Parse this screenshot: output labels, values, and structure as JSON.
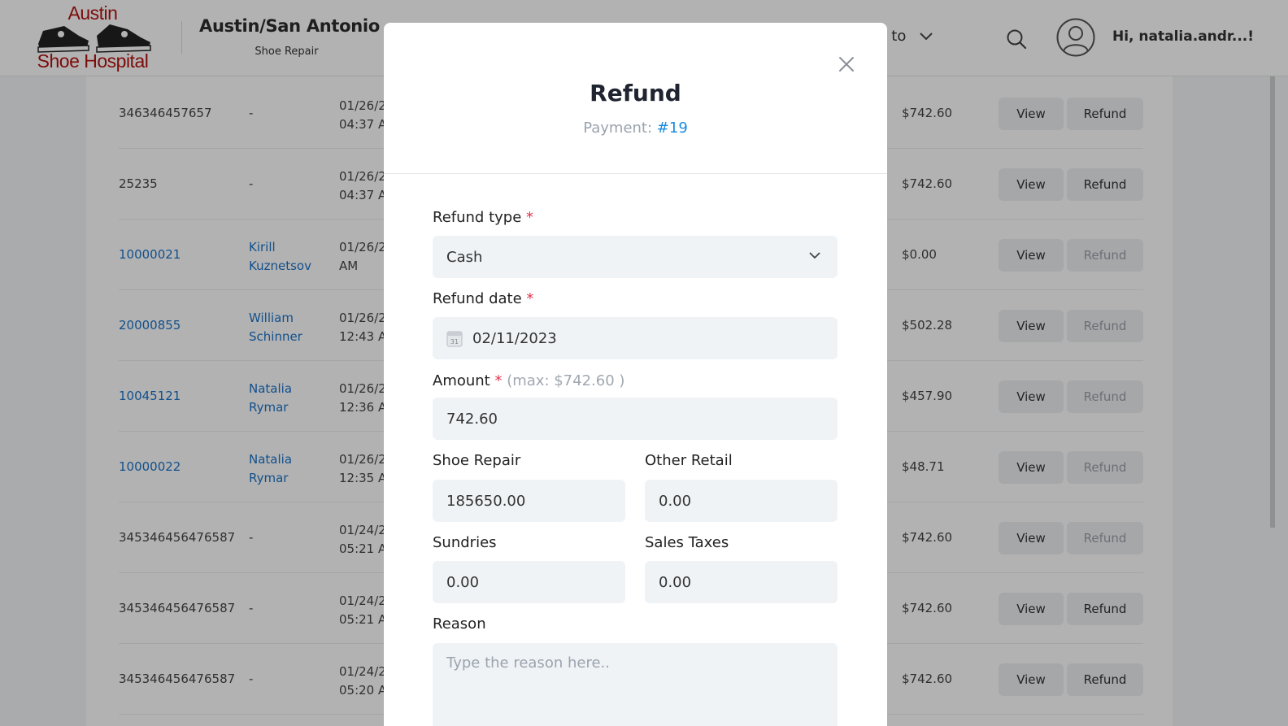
{
  "header": {
    "logo_top": "Austin",
    "logo_bottom": "Shoe Hospital",
    "store_name": "Austin/San Antonio",
    "store_sub": "Shoe Repair",
    "navigate_label": "gate to",
    "greeting": "Hi, natalia.andr...!"
  },
  "table": {
    "rows": [
      {
        "id": "346346457657",
        "name1": "-",
        "name2": "",
        "date1": "01/26/2",
        "date2": "04:37 A",
        "amount": "$742.60",
        "view": "View",
        "refund": "Refund",
        "refund_enabled": true,
        "link": false
      },
      {
        "id": "25235",
        "name1": "-",
        "name2": "",
        "date1": "01/26/2",
        "date2": "04:37 A",
        "amount": "$742.60",
        "view": "View",
        "refund": "Refund",
        "refund_enabled": true,
        "link": false
      },
      {
        "id": "10000021",
        "name1": "Kirill",
        "name2": "Kuznetsov",
        "date1": "01/26/2",
        "date2": "AM",
        "amount": "$0.00",
        "view": "View",
        "refund": "Refund",
        "refund_enabled": false,
        "link": true
      },
      {
        "id": "20000855",
        "name1": "William",
        "name2": "Schinner",
        "date1": "01/26/2",
        "date2": "12:43 A",
        "amount": "$502.28",
        "view": "View",
        "refund": "Refund",
        "refund_enabled": false,
        "link": true
      },
      {
        "id": "10045121",
        "name1": "Natalia",
        "name2": "Rymar",
        "date1": "01/26/2",
        "date2": "12:36 A",
        "amount": "$457.90",
        "view": "View",
        "refund": "Refund",
        "refund_enabled": false,
        "link": true
      },
      {
        "id": "10000022",
        "name1": "Natalia",
        "name2": "Rymar",
        "date1": "01/26/2",
        "date2": "12:35 A",
        "amount": "$48.71",
        "view": "View",
        "refund": "Refund",
        "refund_enabled": false,
        "link": true
      },
      {
        "id": "345346456476587",
        "name1": "-",
        "name2": "",
        "date1": "01/24/2",
        "date2": "05:21 A",
        "amount": "$742.60",
        "view": "View",
        "refund": "Refund",
        "refund_enabled": false,
        "link": false
      },
      {
        "id": "345346456476587",
        "name1": "-",
        "name2": "",
        "date1": "01/24/2",
        "date2": "05:21 A",
        "amount": "$742.60",
        "view": "View",
        "refund": "Refund",
        "refund_enabled": true,
        "link": false
      },
      {
        "id": "345346456476587",
        "name1": "-",
        "name2": "",
        "date1": "01/24/2",
        "date2": "05:20 A",
        "amount": "$742.60",
        "view": "View",
        "refund": "Refund",
        "refund_enabled": true,
        "link": false
      }
    ]
  },
  "modal": {
    "title": "Refund",
    "payment_label": "Payment:",
    "payment_id": "#19",
    "refund_type_label": "Refund type",
    "refund_type_value": "Cash",
    "refund_date_label": "Refund date",
    "refund_date_value": "02/11/2023",
    "calendar_day": "31",
    "amount_label": "Amount",
    "amount_hint": "(max: $742.60 )",
    "amount_value": "742.60",
    "shoe_repair_label": "Shoe Repair",
    "shoe_repair_value": "185650.00",
    "other_retail_label": "Other Retail",
    "other_retail_value": "0.00",
    "sundries_label": "Sundries",
    "sundries_value": "0.00",
    "sales_taxes_label": "Sales Taxes",
    "sales_taxes_value": "0.00",
    "reason_label": "Reason",
    "reason_placeholder": "Type the reason here..",
    "required_mark": "*"
  },
  "colors": {
    "accent": "#1a8be0",
    "link": "#1a73c9",
    "required": "#e2334f",
    "brand": "#b3120f"
  }
}
